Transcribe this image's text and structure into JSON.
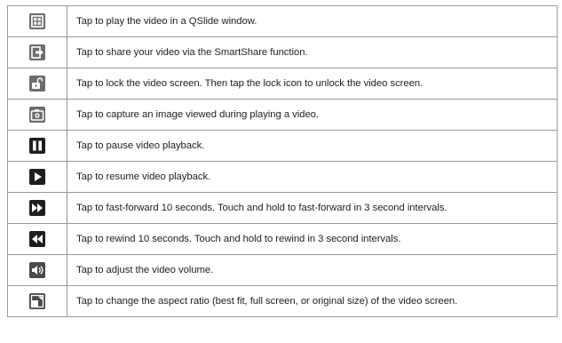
{
  "rows": [
    {
      "icon": "qslide-icon",
      "text": "Tap to play the video in a QSlide window."
    },
    {
      "icon": "share-icon",
      "text": "Tap to share your video via the SmartShare function."
    },
    {
      "icon": "lock-icon",
      "text": "Tap to lock the video screen. Then tap the lock icon to unlock the video screen."
    },
    {
      "icon": "camera-icon",
      "text": "Tap to capture an image viewed during playing a video."
    },
    {
      "icon": "pause-icon",
      "text": "Tap to pause video playback."
    },
    {
      "icon": "play-icon",
      "text": "Tap to resume video playback."
    },
    {
      "icon": "fast-forward-icon",
      "text": "Tap to fast-forward 10 seconds. Touch and hold to fast-forward in 3 second intervals."
    },
    {
      "icon": "rewind-icon",
      "text": "Tap to rewind 10 seconds. Touch and hold to rewind in 3 second intervals."
    },
    {
      "icon": "volume-icon",
      "text": "Tap to adjust the video volume."
    },
    {
      "icon": "aspect-ratio-icon",
      "text": "Tap to change the aspect ratio (best fit, full screen, or original size) of the video screen."
    }
  ]
}
